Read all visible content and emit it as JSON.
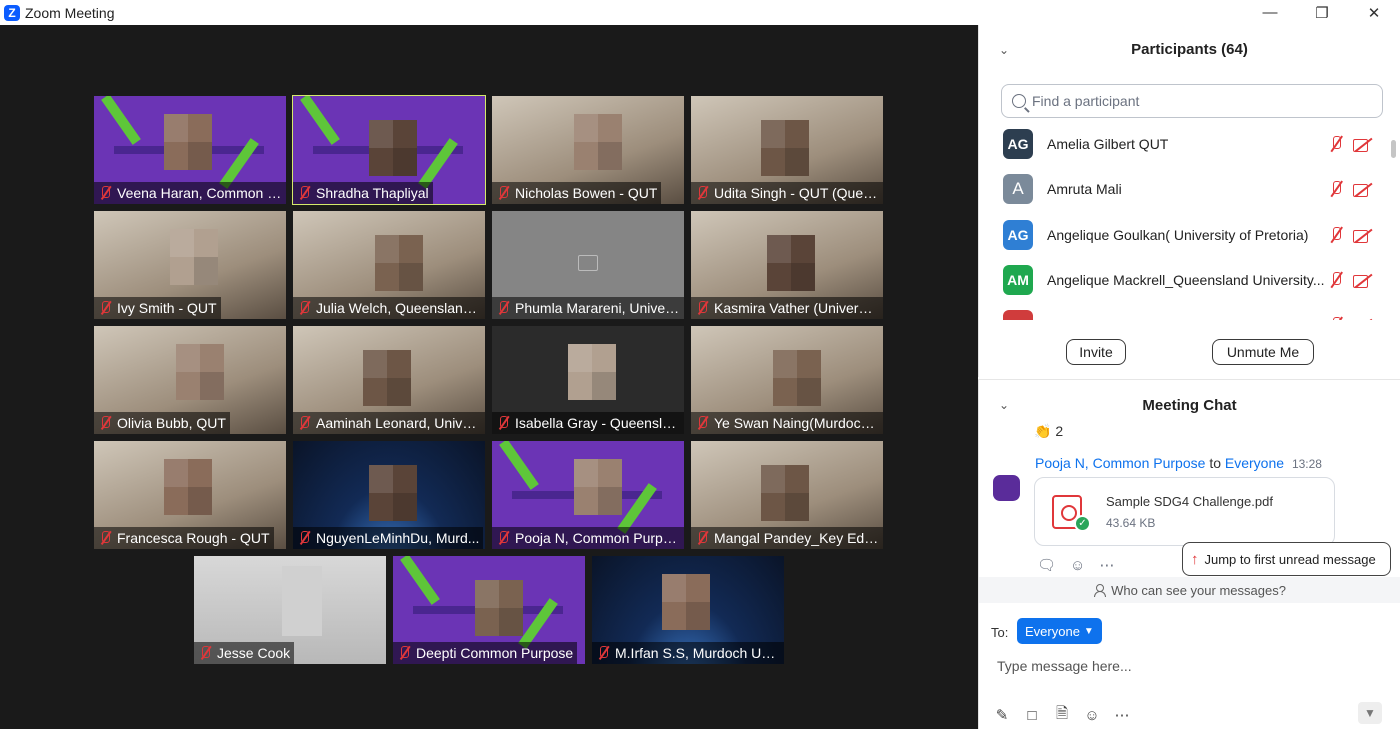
{
  "window": {
    "title": "Zoom Meeting",
    "logo_letter": "Z"
  },
  "tiles": [
    {
      "name": "Veena Haran, Common P...",
      "bg": "purple"
    },
    {
      "name": "Shradha Thapliyal",
      "bg": "purple",
      "active": true
    },
    {
      "name": "Nicholas Bowen - QUT",
      "bg": "room"
    },
    {
      "name": "Udita Singh - QUT (Quee...",
      "bg": "room"
    },
    {
      "name": "Ivy Smith - QUT",
      "bg": "room"
    },
    {
      "name": "Julia Welch, Queensland ...",
      "bg": "room"
    },
    {
      "name": "Phumla Marareni, Univer...",
      "bg": "gray"
    },
    {
      "name": "Kasmira Vather (Universit...",
      "bg": "room"
    },
    {
      "name": "Olivia Bubb, QUT",
      "bg": "room"
    },
    {
      "name": "Aaminah Leonard, Univer...",
      "bg": "room"
    },
    {
      "name": "Isabella Gray - Queensla...",
      "bg": "dark"
    },
    {
      "name": "Ye Swan Naing(Murdoch ...",
      "bg": "room"
    },
    {
      "name": "Francesca Rough - QUT",
      "bg": "room"
    },
    {
      "name": "NguyenLeMinhDu, Murd...",
      "bg": "space"
    },
    {
      "name": "Pooja N, Common Purpose",
      "bg": "purple"
    },
    {
      "name": "Mangal Pandey_Key Educ...",
      "bg": "room"
    },
    {
      "name": "Jesse Cook",
      "bg": "light"
    },
    {
      "name": "Deepti Common Purpose",
      "bg": "purple"
    },
    {
      "name": "M.Irfan S.S, Murdoch Uni...",
      "bg": "space"
    }
  ],
  "participants": {
    "title": "Participants (64)",
    "search_placeholder": "Find a participant",
    "list": [
      {
        "initials": "AG",
        "name": "Amelia Gilbert QUT",
        "color": "#2d3e50"
      },
      {
        "initials": "A",
        "name": "Amruta Mali",
        "color": "#7b8a9a"
      },
      {
        "initials": "AG",
        "name": "Angelique Goulkan( University of Pretoria)",
        "color": "#2f7fd4"
      },
      {
        "initials": "AM",
        "name": "Angelique Mackrell_Queensland University...",
        "color": "#1fa84f"
      },
      {
        "initials": "",
        "name": "",
        "color": "#d03c3c"
      }
    ],
    "invite_label": "Invite",
    "unmute_label": "Unmute Me"
  },
  "chat": {
    "title": "Meeting Chat",
    "prev_reaction": "👏 2",
    "sender": "Pooja N, Common Purpose",
    "to_word": "to",
    "recipient": "Everyone",
    "time": "13:28",
    "file_name": "Sample SDG4 Challenge.pdf",
    "file_size": "43.64 KB",
    "jump_label": "Jump to first unread message",
    "who_can_see": "Who can see your messages?",
    "to_label": "To:",
    "to_value": "Everyone",
    "input_placeholder": "Type message here..."
  }
}
